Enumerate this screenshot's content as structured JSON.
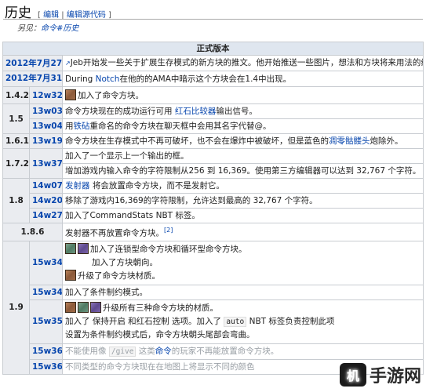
{
  "heading": {
    "title": "历史",
    "edit_links": [
      "编辑",
      "编辑源代码"
    ],
    "see_also_prefix": "另见：",
    "see_also_link": "命令#历史"
  },
  "section_title": "正式版本",
  "colors": {
    "link": "#0645ad",
    "header_bg": "#dfe6ef",
    "version_bg": "#eaecf0",
    "border": "#c8ccd1"
  },
  "rows": {
    "r1": {
      "date": "2012年7月27日",
      "text": "Jeb开始发一些关于扩展生存模式的新方块的推文。他开始推送一些图片，想法和方块将来用法的线索"
    },
    "r2": {
      "date": "2012年7月31日",
      "pre": "During ",
      "link": "Notch",
      "post": "在他的的AMA中暗示这个方块会在1.4中出现。"
    },
    "r3": {
      "ver": "1.4.2",
      "snap": "12w32a",
      "text": "加入了命令方块。"
    },
    "r4": {
      "ver": "1.5",
      "snap": "13w03a",
      "pre": "命令方块现在的成功运行可用 ",
      "link": "红石比较器",
      "post": "输出信号。"
    },
    "r5": {
      "snap": "13w04a",
      "pre": "用",
      "link": "铁砧",
      "post": "重命名的命令方块在聊天框中会用其名字代替@。"
    },
    "r6": {
      "ver": "1.6.1",
      "snap": "13w19a",
      "pre": "命令方块在生存模式中不再可破坏，也不会在爆炸中被破坏，但是蓝色的",
      "link": "凋零骷髅头",
      "post": "炮除外。"
    },
    "r7": {
      "ver": "1.7.2",
      "snap": "13w37a",
      "text": "加入了一个显示上一个输出的框。"
    },
    "r8": {
      "text": "增加游戏内输入命令的字符限制从256 到 16,369。使用第三方编辑器可以达到 32,767 个字符。"
    },
    "r9": {
      "ver": "1.8",
      "snap": "14w07a",
      "link": "发射器",
      "post": " 将会放置命令方块，而不是发射它。"
    },
    "r10": {
      "snap": "14w20a",
      "text": "移除了游戏内16,369的字符限制，允许达到最高的 32,767 个字符。"
    },
    "r11": {
      "snap": "14w27a",
      "text": "加入了CommandStats NBT 标签。"
    },
    "r12": {
      "ver": "1.8.6",
      "text": "发射器不再放置命令方块。",
      "ref": "[2]"
    },
    "r13": {
      "ver": "1.9",
      "snap": "15w34a",
      "line1": "加入了连锁型命令方块和循环型命令方块。",
      "line2": "加入了方块朝向。",
      "line3": "升级了命令方块材质。"
    },
    "r14": {
      "snap": "15w34b",
      "text": "加入了条件制约模式。"
    },
    "r15": {
      "snap": "15w35a",
      "line1": "升级所有三种命令方块的材质。",
      "line2_pre": "加入了 保持开启 和红石控制 选项。加入了 ",
      "line2_code": "auto",
      "line2_post": " NBT 标签负责控制此项",
      "line3": "设置为条件制约模式后，命令方块朝头尾部会弯曲。"
    },
    "r16": {
      "snap": "15w36a",
      "pre": "不能使用像 ",
      "code": "/give",
      "mid": " 这类",
      "link": "命令",
      "post": "的玩家不再能放置命令方块。"
    },
    "r17": {
      "snap": "15w36d",
      "text": "不同类型的命令方块现在在地图上将显示不同的颜色"
    }
  },
  "icons": [
    "impulse-command-block-icon",
    "chain-command-block-icon",
    "repeating-command-block-icon",
    "external-link-icon"
  ],
  "watermark": {
    "text": "手游网",
    "logo": "机"
  }
}
